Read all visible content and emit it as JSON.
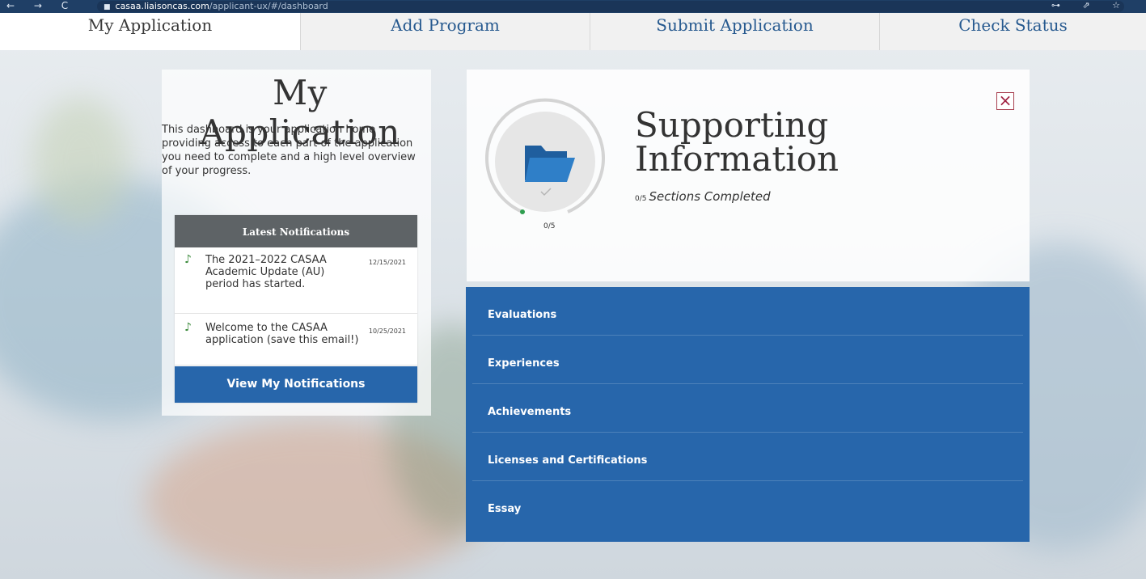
{
  "browser": {
    "nav_icons": "← → C",
    "url_host": "casaa.liaisoncas.com",
    "url_path": "/applicant-ux/#/dashboard",
    "right_icons": "⊶ ⇗ ☆"
  },
  "tabs": [
    {
      "label": "My Application",
      "active": true
    },
    {
      "label": "Add Program",
      "active": false
    },
    {
      "label": "Submit Application",
      "active": false
    },
    {
      "label": "Check Status",
      "active": false
    }
  ],
  "left": {
    "title": "My Application",
    "intro": "This dashboard is your application home providing access to each part of the application you need to complete and a high level overview of your progress."
  },
  "notifications": {
    "header": "Latest Notifications",
    "items": [
      {
        "text": "The 2021–2022 CASAA Academic Update (AU) period has started.",
        "date": "12/15/2021"
      },
      {
        "text": "Welcome to the CASAA application (save this email!)",
        "date": "10/25/2021"
      }
    ],
    "button_label": "View My Notifications"
  },
  "section": {
    "title_line1": "Supporting",
    "title_line2": "Information",
    "completed_count": "0/5",
    "completed_text": "Sections Completed",
    "gauge_label": "0/5",
    "close_glyph": "×",
    "items": [
      {
        "label": "Evaluations"
      },
      {
        "label": "Experiences"
      },
      {
        "label": "Achievements"
      },
      {
        "label": "Licenses and Certifications"
      },
      {
        "label": "Essay"
      }
    ]
  },
  "colors": {
    "primary_blue": "#2766ab",
    "tab_text_blue": "#26598f",
    "notif_header_gray": "#5e6366",
    "close_red": "#a02040"
  }
}
